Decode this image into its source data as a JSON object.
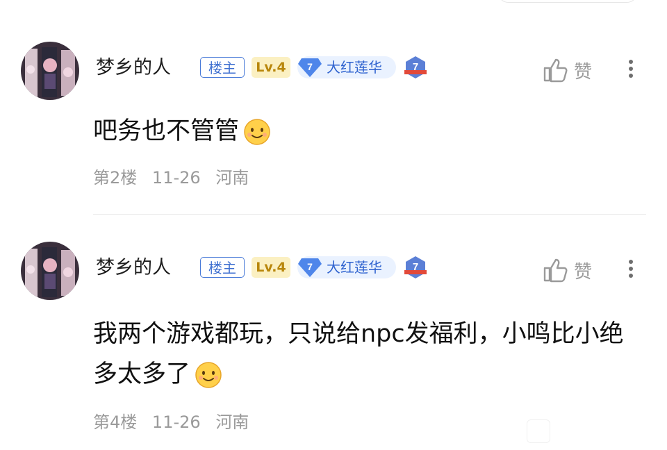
{
  "comments": [
    {
      "username": "梦乡的人",
      "owner_badge": "楼主",
      "level_badge": "Lv.4",
      "fan_level": "7",
      "fan_title": "大红莲华",
      "medal_level": "7",
      "like_label": "赞",
      "content": "吧务也不管管",
      "floor": "第2楼",
      "date": "11-26",
      "location": "河南"
    },
    {
      "username": "梦乡的人",
      "owner_badge": "楼主",
      "level_badge": "Lv.4",
      "fan_level": "7",
      "fan_title": "大红莲华",
      "medal_level": "7",
      "like_label": "赞",
      "content": "我两个游戏都玩，只说给npc发福利，小鸣比小绝多太多了",
      "floor": "第4楼",
      "date": "11-26",
      "location": "河南"
    }
  ],
  "icons": {
    "like": "thumbs-up-icon",
    "more": "more-vertical-icon",
    "emoji": "smiling-face-emoji",
    "medal": "level-medal-icon"
  },
  "colors": {
    "owner_badge": "#4a7bd8",
    "level_badge_bg": "#fbf0c2",
    "fan_badge_bg": "#eaf2ff",
    "meta_text": "#9a9a9a"
  }
}
